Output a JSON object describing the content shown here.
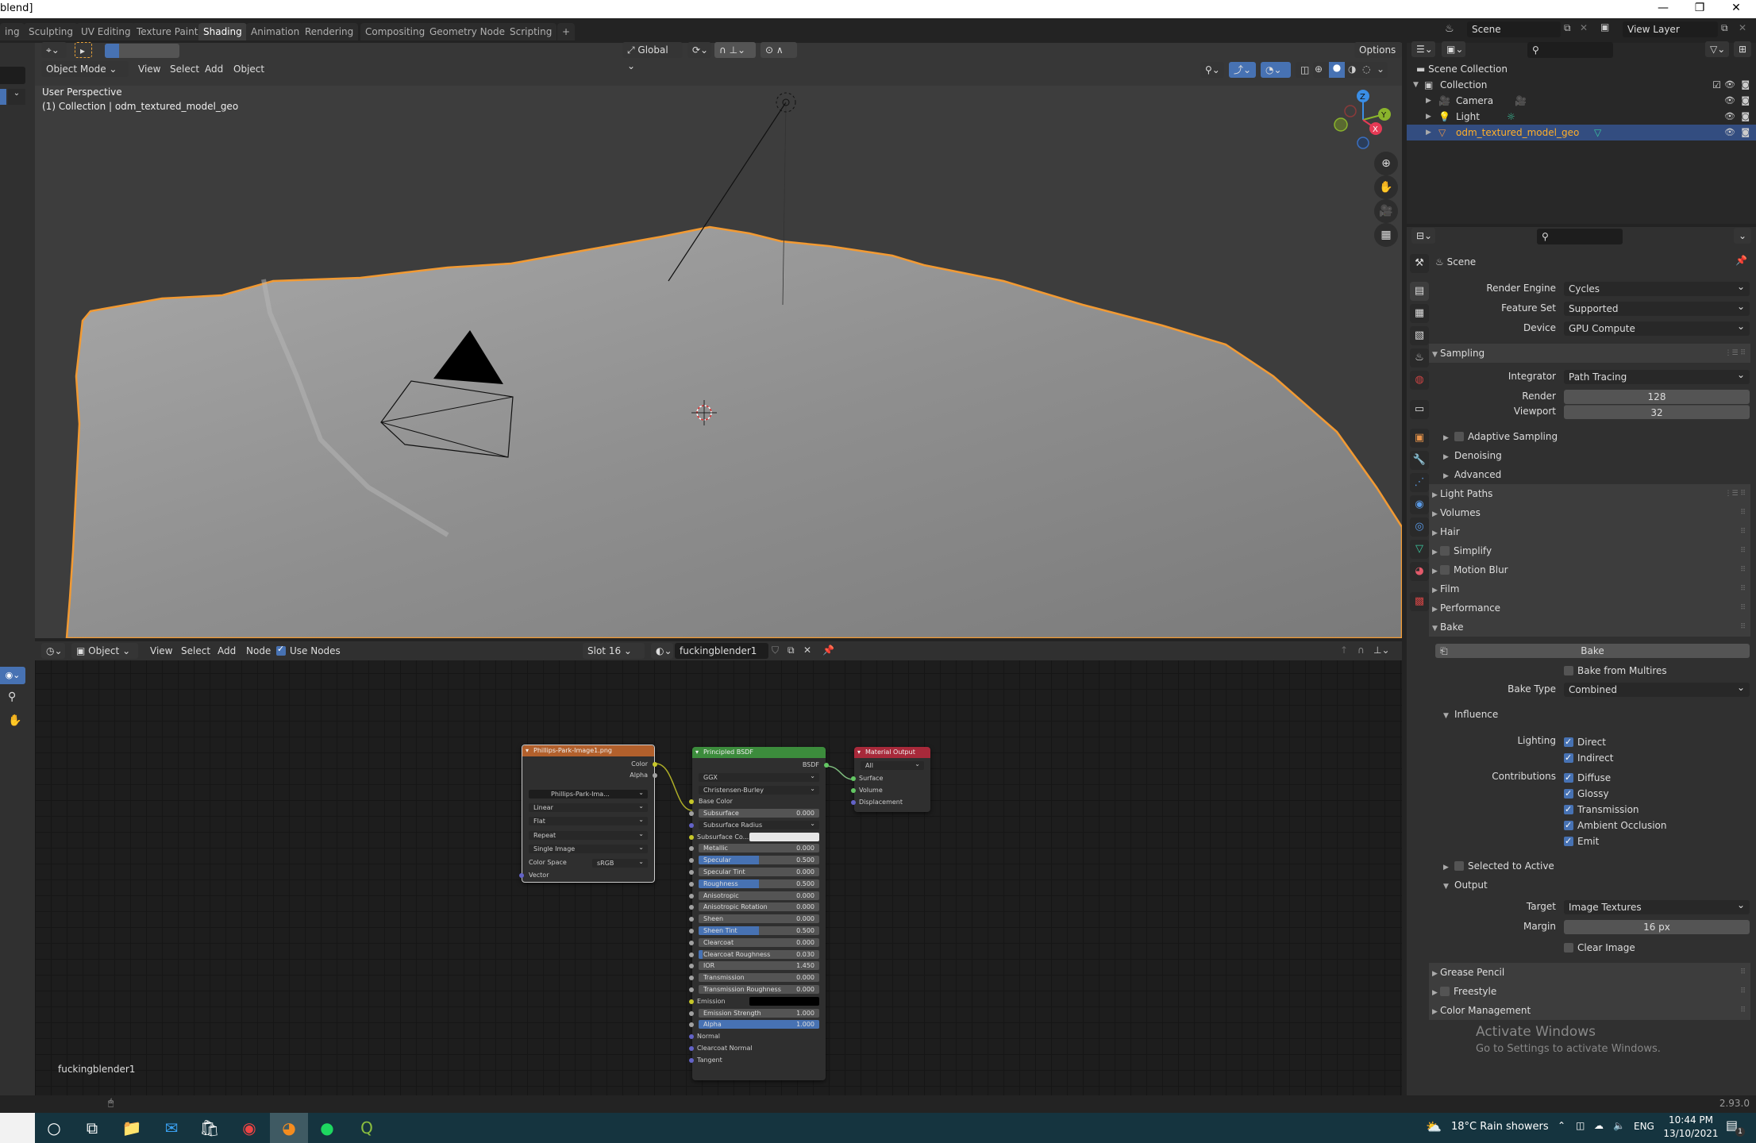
{
  "titlebar": {
    "title": "blend]",
    "minimize": "—",
    "restore": "❐",
    "close": "✕"
  },
  "workspaces": [
    "ing",
    "Sculpting",
    "UV Editing",
    "Texture Paint",
    "Shading",
    "Animation",
    "Rendering",
    "Compositing",
    "Geometry Nodes",
    "Scripting",
    "+"
  ],
  "active_workspace": "Shading",
  "scene_selector": {
    "label": "Scene"
  },
  "viewlayer_selector": {
    "label": "View Layer"
  },
  "viewport": {
    "mode": "Object Mode",
    "menus": [
      "View",
      "Select",
      "Add",
      "Object"
    ],
    "transform_orientation": "Global",
    "options_label": "Options",
    "overlay_line1": "User Perspective",
    "overlay_line2": "(1) Collection | odm_textured_model_geo",
    "gizmo": {
      "z": "Z",
      "y": "Y",
      "x": "X"
    }
  },
  "outliner": {
    "root": "Scene Collection",
    "items": [
      {
        "name": "Collection",
        "level": 0
      },
      {
        "name": "Camera",
        "level": 1
      },
      {
        "name": "Light",
        "level": 1
      },
      {
        "name": "odm_textured_model_geo",
        "level": 1,
        "selected": true
      }
    ]
  },
  "properties": {
    "context": "Scene",
    "render_engine": {
      "label": "Render Engine",
      "value": "Cycles"
    },
    "feature_set": {
      "label": "Feature Set",
      "value": "Supported"
    },
    "device": {
      "label": "Device",
      "value": "GPU Compute"
    },
    "sampling": {
      "title": "Sampling",
      "integrator_label": "Integrator",
      "integrator": "Path Tracing",
      "render_label": "Render",
      "render": "128",
      "viewport_label": "Viewport",
      "viewport": "32",
      "subpanels": [
        "Adaptive Sampling",
        "Denoising",
        "Advanced"
      ]
    },
    "panels": [
      "Light Paths",
      "Volumes",
      "Hair",
      "Simplify",
      "Motion Blur",
      "Film",
      "Performance"
    ],
    "bake": {
      "title": "Bake",
      "button": "Bake",
      "from_multires": "Bake from Multires",
      "type_label": "Bake Type",
      "type": "Combined",
      "influence": "Influence",
      "lighting_label": "Lighting",
      "direct": "Direct",
      "indirect": "Indirect",
      "contributions_label": "Contributions",
      "contributions": [
        "Diffuse",
        "Glossy",
        "Transmission",
        "Ambient Occlusion",
        "Emit"
      ],
      "selected_to_active": "Selected to Active",
      "output": "Output",
      "target_label": "Target",
      "target": "Image Textures",
      "margin_label": "Margin",
      "margin": "16 px",
      "clear_image": "Clear Image"
    },
    "panels_after": [
      "Grease Pencil",
      "Freestyle",
      "Color Management"
    ],
    "activate_title": "Activate Windows",
    "activate_sub": "Go to Settings to activate Windows."
  },
  "node_editor": {
    "object_label": "Object",
    "menus": [
      "View",
      "Select",
      "Add",
      "Node"
    ],
    "use_nodes": "Use Nodes",
    "slot": "Slot 16",
    "material": "fuckingblender1",
    "footer_label": "fuckingblender1"
  },
  "image_node": {
    "title": "Phillips-Park-Image1.png",
    "out_color": "Color",
    "out_alpha": "Alpha",
    "image": "Phillips-Park-Ima...",
    "interp": "Linear",
    "proj": "Flat",
    "ext": "Repeat",
    "source": "Single Image",
    "cs_label": "Color Space",
    "cs": "sRGB",
    "in_vector": "Vector"
  },
  "bsdf_node": {
    "title": "Principled BSDF",
    "out": "BSDF",
    "distribution": "GGX",
    "sss_method": "Christensen-Burley",
    "base_color": "Base Color",
    "fields": [
      {
        "label": "Subsurface",
        "value": "0.000",
        "fill": 0
      },
      {
        "label": "Subsurface Radius",
        "dropdown": true
      },
      {
        "label": "Subsurface Co...",
        "color": "#e8e8e8"
      },
      {
        "label": "Metallic",
        "value": "0.000",
        "fill": 0
      },
      {
        "label": "Specular",
        "value": "0.500",
        "fill": 0.5
      },
      {
        "label": "Specular Tint",
        "value": "0.000",
        "fill": 0
      },
      {
        "label": "Roughness",
        "value": "0.500",
        "fill": 0.5
      },
      {
        "label": "Anisotropic",
        "value": "0.000",
        "fill": 0
      },
      {
        "label": "Anisotropic Rotation",
        "value": "0.000",
        "fill": 0
      },
      {
        "label": "Sheen",
        "value": "0.000",
        "fill": 0
      },
      {
        "label": "Sheen Tint",
        "value": "0.500",
        "fill": 0.5
      },
      {
        "label": "Clearcoat",
        "value": "0.000",
        "fill": 0
      },
      {
        "label": "Clearcoat Roughness",
        "value": "0.030",
        "fill": 0.03
      },
      {
        "label": "IOR",
        "value": "1.450",
        "fill": 0
      },
      {
        "label": "Transmission",
        "value": "0.000",
        "fill": 0
      },
      {
        "label": "Transmission Roughness",
        "value": "0.000",
        "fill": 0
      },
      {
        "label": "Emission",
        "color": "#000000"
      },
      {
        "label": "Emission Strength",
        "value": "1.000",
        "fill": 0
      },
      {
        "label": "Alpha",
        "value": "1.000",
        "fill": 1
      }
    ],
    "inputs_bottom": [
      "Normal",
      "Clearcoat Normal",
      "Tangent"
    ]
  },
  "output_node": {
    "title": "Material Output",
    "target": "All",
    "inputs": [
      "Surface",
      "Volume",
      "Displacement"
    ]
  },
  "statusbar": {
    "version": "2.93.0"
  },
  "taskbar": {
    "weather": "18°C  Rain showers",
    "lang": "ENG",
    "time": "10:44 PM",
    "date": "13/10/2021",
    "notif_count": "1"
  },
  "colors": {
    "accent": "#4772b3",
    "selection": "#ffa033",
    "image_node": "#b2602c",
    "bsdf_node": "#3c8c3c",
    "output_node": "#a8293a"
  }
}
